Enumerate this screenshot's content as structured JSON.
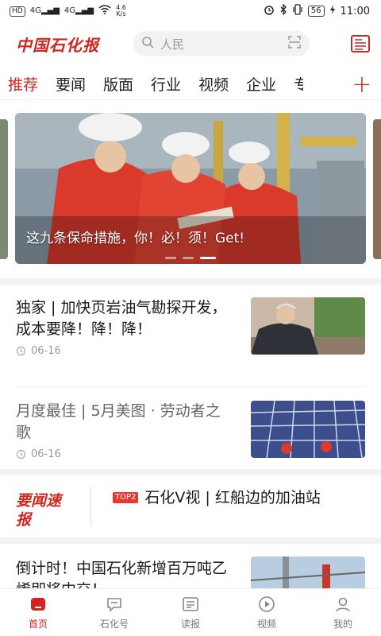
{
  "status_bar": {
    "hd": "HD",
    "sim1": "4G",
    "sim2": "4G",
    "speed_value": "4.6",
    "speed_unit": "K/s",
    "battery": "56",
    "time": "11:00"
  },
  "header": {
    "logo_text": "中国石化报",
    "search_placeholder": "人民"
  },
  "tabs": [
    {
      "label": "推荐",
      "active": true
    },
    {
      "label": "要闻"
    },
    {
      "label": "版面"
    },
    {
      "label": "行业"
    },
    {
      "label": "视频"
    },
    {
      "label": "企业"
    },
    {
      "label": "专"
    }
  ],
  "tab_add_label": "+",
  "banner": {
    "caption": "这九条保命措施，你！必！须！Get!"
  },
  "articles": [
    {
      "title": "独家 | 加快页岩油气勘探开发，成本要降！降！降！",
      "date": "06-16"
    },
    {
      "title": "月度最佳 | 5月美图 · 劳动者之歌",
      "date": "06-16"
    },
    {
      "title": "倒计时！中国石化新增百万吨乙烯即将中交！"
    }
  ],
  "quick_news": {
    "logo": "要闻速报",
    "badge": "TOP2",
    "text": "石化V视 | 红船边的加油站"
  },
  "bottom_nav": [
    {
      "label": "首页",
      "active": true
    },
    {
      "label": "石化号"
    },
    {
      "label": "读报"
    },
    {
      "label": "视频"
    },
    {
      "label": "我的"
    }
  ],
  "colors": {
    "accent": "#d0261f"
  }
}
